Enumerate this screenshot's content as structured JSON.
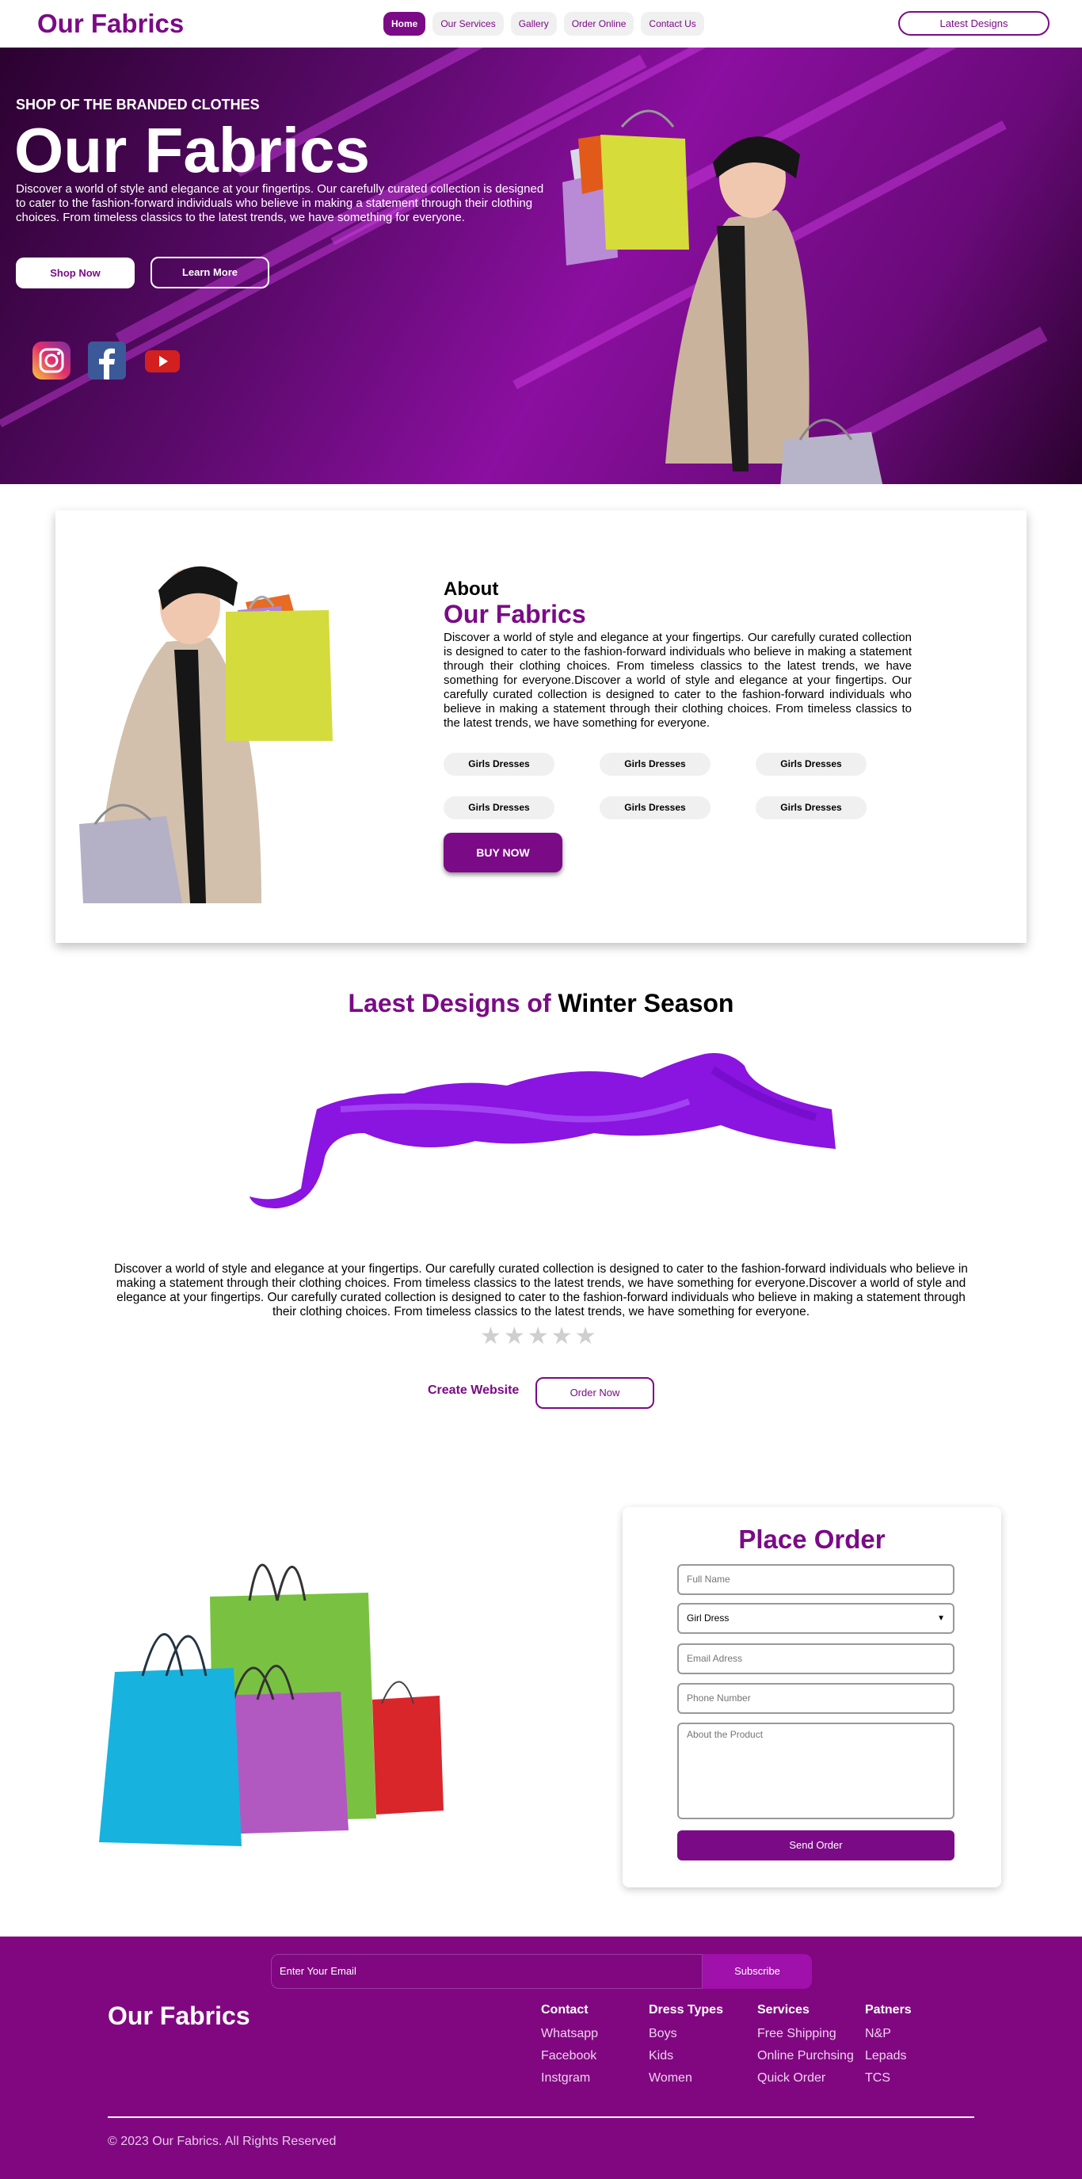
{
  "nav": {
    "logo": "Our Fabrics",
    "links": [
      "Home",
      "Our Services",
      "Gallery",
      "Order Online",
      "Contact Us"
    ],
    "cta": "Latest Designs"
  },
  "hero": {
    "subtitle": "SHOP OF THE BRANDED CLOTHES",
    "title": "Our Fabrics",
    "text": "Discover a world of style and elegance at your fingertips. Our carefully curated collection is designed to cater to the fashion-forward individuals who believe in making a statement through their clothing choices. From timeless classics to the latest trends, we have something for everyone.",
    "shop_btn": "Shop Now",
    "learn_btn": "Learn More",
    "social_icons": [
      "instagram-icon",
      "facebook-icon",
      "youtube-icon"
    ]
  },
  "about": {
    "heading": "About",
    "title": "Our Fabrics",
    "text": "Discover a world of style and elegance at your fingertips. Our carefully curated collection is designed to cater to the fashion-forward individuals who believe in making a statement through their clothing choices. From timeless classics to the latest trends, we have something for everyone.Discover a world of style and elegance at your fingertips. Our carefully curated collection is designed to cater to the fashion-forward individuals who believe in making a statement through their clothing choices. From timeless classics to the latest trends, we have something for everyone.",
    "tags": [
      "Girls Dresses",
      "Girls Dresses",
      "Girls Dresses",
      "Girls Dresses",
      "Girls Dresses",
      "Girls Dresses"
    ],
    "buy_btn": "BUY NOW"
  },
  "winter": {
    "title_a": "Laest Designs of",
    "title_b": "Winter Season",
    "text": "Discover a world of style and elegance at your fingertips. Our carefully curated collection is designed to cater to the fashion-forward individuals who believe in making a statement through their clothing choices. From timeless classics to the latest trends, we have something for everyone.Discover a world of style and elegance at your fingertips. Our carefully curated collection is designed to cater to the fashion-forward individuals who believe in making a statement through their clothing choices. From timeless classics to the latest trends, we have something for everyone.",
    "stars": "★★★★★",
    "rating": 0,
    "create_link": "Create Website",
    "order_btn": "Order Now"
  },
  "order": {
    "title": "Place Order",
    "name_ph": "Full Name",
    "select_value": "Girl Dress",
    "email_ph": "Email Adress",
    "phone_ph": "Phone Number",
    "about_ph": "About the Product",
    "send_btn": "Send Order"
  },
  "footer": {
    "email_ph": "Enter Your Email",
    "subscribe": "Subscribe",
    "logo": "Our Fabrics",
    "cols": [
      {
        "title": "Contact",
        "items": [
          "Whatsapp",
          "Facebook",
          "Instgram"
        ]
      },
      {
        "title": "Dress Types",
        "items": [
          "Boys",
          "Kids",
          "Women"
        ]
      },
      {
        "title": "Services",
        "items": [
          "Free Shipping",
          "Online Purchsing",
          "Quick Order"
        ]
      },
      {
        "title": "Patners",
        "items": [
          "N&P",
          "Lepads",
          "TCS"
        ]
      }
    ],
    "copyright": "© 2023 Our Fabrics. All Rights Reserved"
  },
  "colors": {
    "brand": "#7b0a86",
    "footer": "#810781"
  }
}
